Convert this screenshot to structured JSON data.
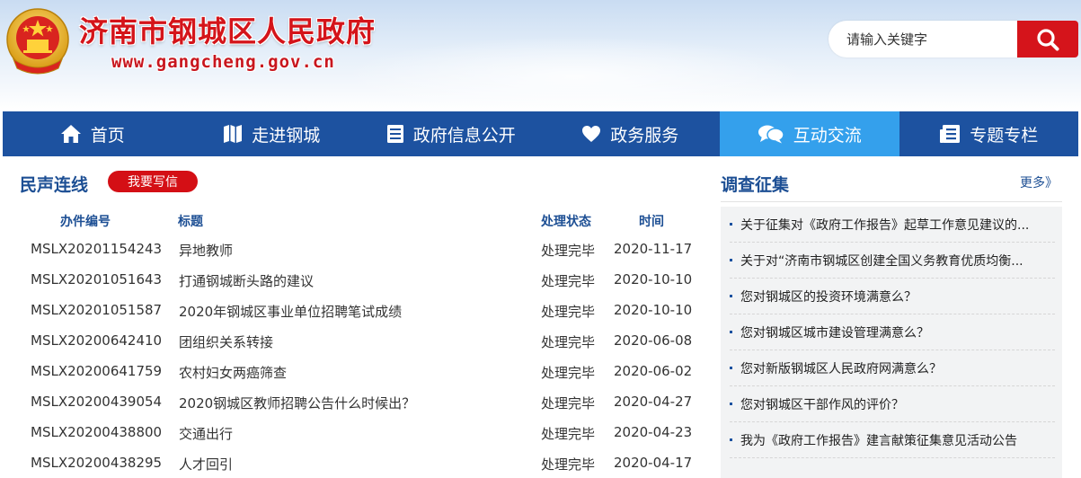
{
  "header": {
    "title": "济南市钢城区人民政府",
    "url": "www.gangcheng.gov.cn",
    "search_placeholder": "请输入关键字"
  },
  "nav": [
    {
      "label": "首页",
      "icon": "home-icon"
    },
    {
      "label": "走进钢城",
      "icon": "map-icon"
    },
    {
      "label": "政府信息公开",
      "icon": "document-list-icon"
    },
    {
      "label": "政务服务",
      "icon": "heart-icon"
    },
    {
      "label": "互动交流",
      "icon": "chat-icon",
      "active": true
    },
    {
      "label": "专题专栏",
      "icon": "newspaper-icon"
    }
  ],
  "letters": {
    "title": "民声连线",
    "write_button": "我要写信",
    "columns": {
      "id": "办件编号",
      "title": "标题",
      "status": "处理状态",
      "date": "时间"
    },
    "rows": [
      {
        "id": "MSLX20201154243",
        "title": "异地教师",
        "status": "处理完毕",
        "date": "2020-11-17"
      },
      {
        "id": "MSLX20201051643",
        "title": "打通钢城断头路的建议",
        "status": "处理完毕",
        "date": "2020-10-10"
      },
      {
        "id": "MSLX20201051587",
        "title": "2020年钢城区事业单位招聘笔试成绩",
        "status": "处理完毕",
        "date": "2020-10-10"
      },
      {
        "id": "MSLX20200642410",
        "title": "团组织关系转接",
        "status": "处理完毕",
        "date": "2020-06-08"
      },
      {
        "id": "MSLX20200641759",
        "title": "农村妇女两癌筛查",
        "status": "处理完毕",
        "date": "2020-06-02"
      },
      {
        "id": "MSLX20200439054",
        "title": "2020钢城区教师招聘公告什么时候出？",
        "status": "处理完毕",
        "date": "2020-04-27"
      },
      {
        "id": "MSLX20200438800",
        "title": "交通出行",
        "status": "处理完毕",
        "date": "2020-04-23"
      },
      {
        "id": "MSLX20200438295",
        "title": "人才回引",
        "status": "处理完毕",
        "date": "2020-04-17"
      }
    ]
  },
  "survey": {
    "title": "调查征集",
    "more": "更多》",
    "items": [
      "关于征集对《政府工作报告》起草工作意见建议的...",
      "关于对“济南市钢城区创建全国义务教育优质均衡...",
      "您对钢城区的投资环境满意么？",
      "您对钢城区城市建设管理满意么？",
      "您对新版钢城区人民政府网满意么？",
      "您对钢城区干部作风的评价？",
      "我为《政府工作报告》建言献策征集意见活动公告"
    ]
  },
  "colors": {
    "brand_red": "#d5141b",
    "nav_blue": "#1d52a0",
    "nav_active": "#34a0ec",
    "heading_blue": "#1d4f94"
  }
}
